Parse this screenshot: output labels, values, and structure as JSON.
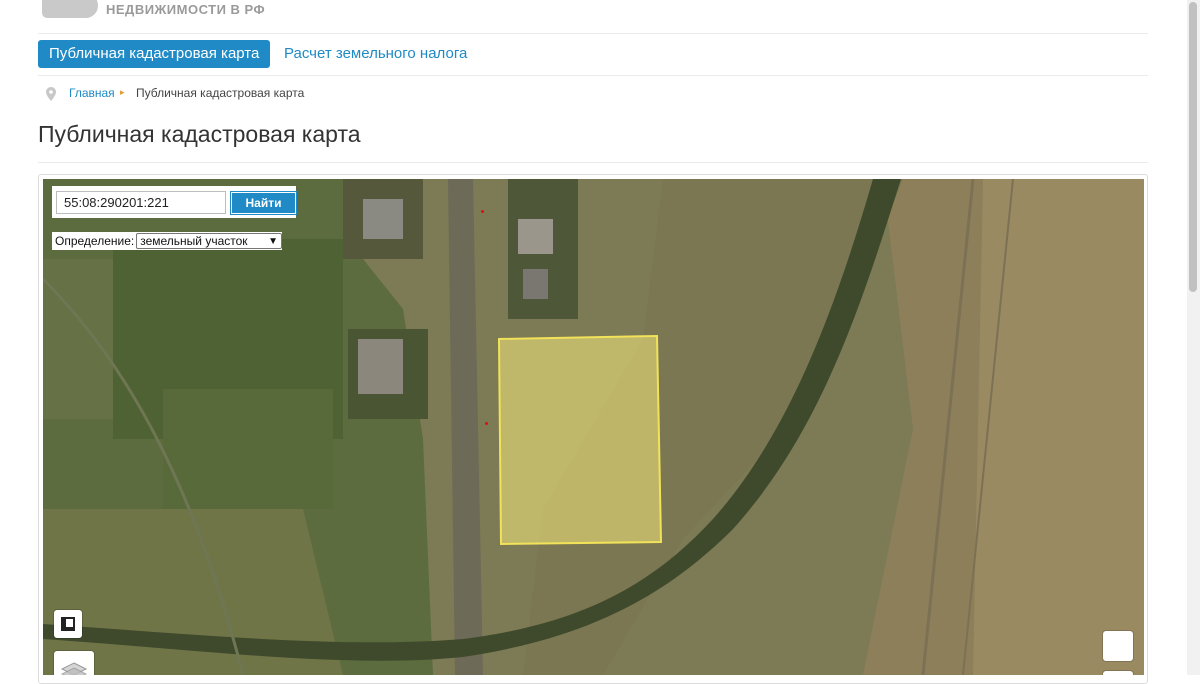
{
  "header": {
    "brand_text": "НЕДВИЖИМОСТИ В РФ"
  },
  "nav": {
    "active_label": "Публичная кадастровая карта",
    "link_label": "Расчет земельного налога"
  },
  "breadcrumb": {
    "home": "Главная",
    "separator": "▸",
    "current": "Публичная кадастровая карта"
  },
  "page": {
    "title": "Публичная кадастровая карта"
  },
  "map": {
    "search_value": "55:08:290201:221",
    "search_button": "Найти",
    "definition_label": "Определение:",
    "definition_selected": "земельный участок",
    "definition_chevron": "▼",
    "parcel_fill": "#f5ea7a",
    "parcel_stroke": "#f1e25a"
  },
  "colors": {
    "accent": "#1f8ac5",
    "breadcrumb_arrow": "#e39b2d"
  },
  "icons": {
    "breadcrumb": "map-pin-icon",
    "layers": "layers-icon",
    "print": "print-icon"
  }
}
